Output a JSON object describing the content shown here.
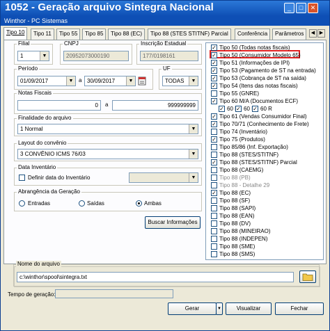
{
  "window": {
    "title": "1052 - Geração arquivo Sintegra Nacional",
    "subtitle": "Winthor - PC Sistemas",
    "minimize": "_",
    "maximize": "□",
    "close": "✕"
  },
  "tabs": [
    {
      "label": "Tipo 10"
    },
    {
      "label": "Tipo 11"
    },
    {
      "label": "Tipo 55"
    },
    {
      "label": "Tipo 85"
    },
    {
      "label": "Tipo 88 (EC)"
    },
    {
      "label": "Tipo 88 (STES STITNF) Parcial"
    },
    {
      "label": "Conferência"
    },
    {
      "label": "Parâmetros"
    }
  ],
  "filial": {
    "label": "Filial",
    "value": "1"
  },
  "cnpj": {
    "label": "CNPJ",
    "value": "20952073000190"
  },
  "inscricao": {
    "label": "Inscrição Estadual",
    "value": "177/0198161"
  },
  "periodo": {
    "label": "Período",
    "start": "01/09/2017",
    "sep": "a",
    "end": "30/09/2017"
  },
  "uf": {
    "label": "UF",
    "value": "TODAS"
  },
  "notas": {
    "label": "Notas Fiscais",
    "start": "0",
    "sep": "a",
    "end": "999999999"
  },
  "finalidade": {
    "label": "Finalidade do arquivo",
    "value": "1 Normal"
  },
  "layout": {
    "label": "Layout do convênio",
    "value": "3 CONVÊNIO ICMS 76/03"
  },
  "inventario": {
    "label": "Data Inventário",
    "checkbox_label": "Definir data do Inventário"
  },
  "abrangencia": {
    "label": "Abrangência da Geração",
    "options": [
      "Entradas",
      "Saídas",
      "Ambas"
    ],
    "selected": "Ambas"
  },
  "buscar_button": "Buscar Informações",
  "tipos": [
    {
      "label": "Tipo 50 (Todas notas fiscais)",
      "checked": true
    },
    {
      "label": "Tipo 50 (Consumidor Modelo 65)",
      "checked": true
    },
    {
      "label": "Tipo 51 (Informações de IPI)",
      "checked": true
    },
    {
      "label": "Tipo 53 (Pagamento de ST na entrada)",
      "checked": true
    },
    {
      "label": "Tipo 53 (Cobrança de ST na saída)",
      "checked": true
    },
    {
      "label": "Tipo 54 (Itens das notas fiscais)",
      "checked": true
    },
    {
      "label": "Tipo 55 (GNRE)",
      "checked": false
    },
    {
      "label": "Tipo 60 M/A (Documentos ECF)",
      "checked": true
    },
    {
      "label": "Tipo 61 (Vendas Consumidor Final)",
      "checked": true
    },
    {
      "label": "Tipo 70/71 (Conhecimento de Frete)",
      "checked": true
    },
    {
      "label": "Tipo 74 (Inventário)",
      "checked": false
    },
    {
      "label": "Tipo 75 (Produtos)",
      "checked": true
    },
    {
      "label": "Tipo 85/86 (Inf. Exportação)",
      "checked": false
    },
    {
      "label": "Tipo 88 (STES/STITNF)",
      "checked": false
    },
    {
      "label": "Tipo 88 (STES/STITNF) Parcial",
      "checked": true
    },
    {
      "label": "Tipo 88 (CAEMG)",
      "checked": false
    },
    {
      "label": "Tipo 88 (PB)",
      "checked": false,
      "disabled": true
    },
    {
      "label": "Tipo 88 - Detalhe 29",
      "checked": false,
      "disabled": true
    },
    {
      "label": "Tipo 88 (EC)",
      "checked": true
    },
    {
      "label": "Tipo 88 (SF)",
      "checked": false
    },
    {
      "label": "Tipo 88 (SAPI)",
      "checked": false
    },
    {
      "label": "Tipo 88 (EAN)",
      "checked": false
    },
    {
      "label": "Tipo 88 (DV)",
      "checked": false
    },
    {
      "label": "Tipo 88 (MINEIRAO)",
      "checked": false
    },
    {
      "label": "Tipo 88 (INDEPEN)",
      "checked": false
    },
    {
      "label": "Tipo 88 (SME)",
      "checked": false
    },
    {
      "label": "Tipo 88 (SMS)",
      "checked": false
    }
  ],
  "sub60": [
    {
      "label": "60 D",
      "checked": true
    },
    {
      "label": "60 I",
      "checked": true
    },
    {
      "label": "60 R",
      "checked": true
    }
  ],
  "arquivo": {
    "label": "Nome do arquivo",
    "value": "c:\\winthor\\spool\\sintegra.txt"
  },
  "tempo": {
    "label": "Tempo de geração:"
  },
  "buttons": {
    "gerar": "Gerar",
    "visualizar": "Visualizar",
    "fechar": "Fechar"
  },
  "colors": {
    "title_bar": "#0e4fb5",
    "highlight": "#e02020"
  }
}
